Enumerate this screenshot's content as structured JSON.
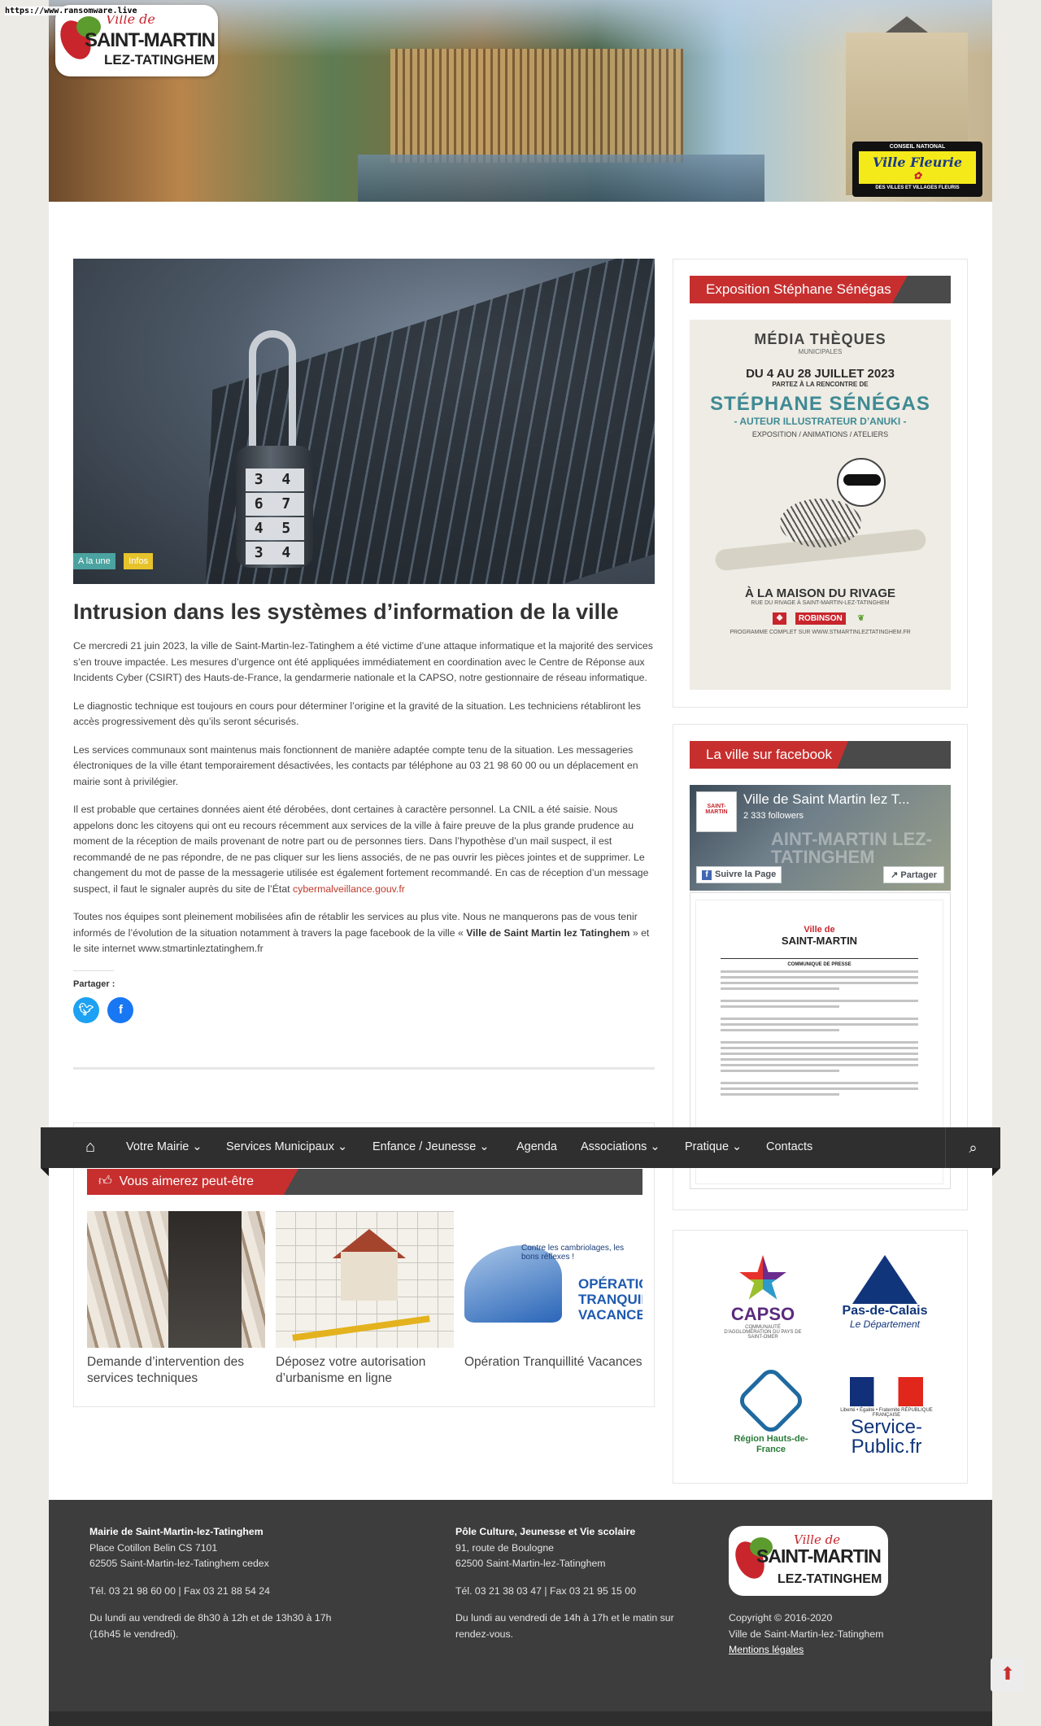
{
  "overlay_url": "https://www.ransomware.live",
  "site": {
    "logo_line1": "Ville de",
    "logo_line2": "SAINT-MARTIN",
    "logo_line3": "LEZ-TATINGHEM",
    "badge_top": "CONSEIL NATIONAL",
    "badge_mid": "Ville Fleurie",
    "badge_bot": "DES VILLES ET VILLAGES FLEURIS"
  },
  "article": {
    "tags": [
      "A la une",
      "Infos"
    ],
    "title": "Intrusion dans les systèmes d’information de la ville",
    "p1": "Ce mercredi 21 juin 2023, la ville de Saint-Martin-lez-Tatinghem a été victime d’une attaque informatique et la majorité des services s’en trouve impactée. Les mesures d’urgence ont été appliquées immédiatement en coordination avec le Centre de Réponse aux Incidents Cyber (CSIRT) des Hauts-de-France, la gendarmerie nationale et la CAPSO, notre gestionnaire de réseau informatique.",
    "p2": "Le diagnostic technique est toujours en cours pour déterminer l’origine et la gravité de la situation. Les techniciens rétabliront les accès progressivement dès qu’ils seront sécurisés.",
    "p3": "Les services communaux sont maintenus mais fonctionnent de manière adaptée compte tenu de la situation. Les messageries électroniques de la ville étant temporairement désactivées, les contacts par téléphone au 03 21 98 60 00 ou un déplacement en mairie sont à privilégier.",
    "p4": "Il est probable que certaines données aient été dérobées, dont certaines à caractère personnel. La CNIL a été saisie. Nous appelons donc les citoyens qui ont eu recours récemment aux services de la ville à faire preuve de la plus grande prudence au moment de la réception de mails provenant de notre part ou de personnes tiers. Dans l’hypothèse d’un mail suspect, il est recommandé de ne pas répondre, de ne pas cliquer sur les liens associés, de ne pas ouvrir les pièces jointes et de supprimer. Le changement du mot de passe de la messagerie utilisée est également fortement recommandé. En cas de réception d’un message suspect, il faut le signaler auprès du site de l’État",
    "p4_link": "cybermalveillance.gouv.fr",
    "p5_a": "Toutes nos équipes sont pleinement mobilisées afin de rétablir les services au plus vite. Nous ne manquerons pas de vous tenir informés de l’évolution de la situation notamment à travers la page facebook de la ville «",
    "p5_strong": "Ville de Saint Martin lez Tatinghem",
    "p5_b": "» et le site internet www.stmartinleztatinghem.fr",
    "share_label": "Partager :",
    "lock_digits": [
      "3 4",
      "6 7",
      "4 5",
      "3 4"
    ]
  },
  "nav": {
    "items": [
      "Votre Mairie ⌄",
      "Services Municipaux ⌄",
      "Enfance / Jeunesse ⌄",
      "Agenda",
      "Associations ⌄",
      "Pratique ⌄",
      "Contacts"
    ]
  },
  "related": {
    "title": "Vous aimerez peut-être",
    "cards": [
      {
        "caption": "Demande d’intervention des services techniques"
      },
      {
        "caption": "Déposez votre autorisation d’urbanisme en ligne"
      },
      {
        "caption": "Opération Tranquillité Vacances"
      }
    ],
    "ops_line": "Contre les cambriolages, les bons réflexes !",
    "ops_title": "OPÉRATION TRANQUILLITÉ VACANCES"
  },
  "sidebar": {
    "expo_title": "Exposition Stéphane Sénégas",
    "poster": {
      "media": "MÉDIA THÈQUES",
      "media_sub": "MUNICIPALES",
      "dates": "DU 4 AU 28 JUILLET 2023",
      "meet": "PARTEZ À LA RENCONTRE DE",
      "name": "STÉPHANE SÉNÉGAS",
      "role": "- AUTEUR ILLUSTRATEUR D’ANUKI -",
      "expo": "EXPOSITION / ANIMATIONS / ATELIERS",
      "maison": "À LA MAISON DU RIVAGE",
      "addr": "RUE DU RIVAGE À SAINT-MARTIN-LEZ-TATINGHEM",
      "logo_robinson": "ROBINSON",
      "prog": "PROGRAMME COMPLET SUR WWW.STMARTINLEZTATINGHEM.FR"
    },
    "fb_title": "La ville sur facebook",
    "fb": {
      "page_name": "Ville de Saint Martin lez T...",
      "followers": "2 333 followers",
      "follow_btn": "Suivre la Page",
      "share_btn": "Partager",
      "watermark": "AINT-MARTIN LEZ-TATINGHEM",
      "doc_title": "COMMUNIQUE DE PRESSE",
      "doc_logo": "SAINT-MARTIN"
    },
    "partners": {
      "capso": "CAPSO",
      "capso_sub": "COMMUNAUTÉ D'AGGLOMÉRATION DU PAYS DE SAINT-OMER",
      "pdc": "Pas-de-Calais",
      "pdc_sub": "Le Département",
      "hdf": "Région Hauts-de-France",
      "rf": "Liberté • Égalité • Fraternité RÉPUBLIQUE FRANÇAISE",
      "sp": "Service-Public.fr"
    }
  },
  "footer": {
    "c1_title": "Mairie de Saint-Martin-lez-Tatinghem",
    "c1_addr1": "Place Cotillon Belin CS 7101",
    "c1_addr2": "62505 Saint-Martin-lez-Tatinghem cedex",
    "c1_tel": "Tél. 03 21 98 60 00 | Fax 03 21 88 54 24",
    "c1_hours": "Du lundi au vendredi de 8h30 à 12h et de 13h30 à 17h (16h45 le vendredi).",
    "c2_title": "Pôle Culture, Jeunesse et Vie scolaire",
    "c2_addr1": "91, route de Boulogne",
    "c2_addr2": "62500 Saint-Martin-lez-Tatinghem",
    "c2_tel": "Tél. 03 21 38 03 47 | Fax 03 21 95 15 00",
    "c2_hours": "Du lundi au vendredi de 14h à 17h et le matin sur rendez-vous.",
    "copyright": "Copyright © 2016-2020",
    "org": "Ville de Saint-Martin-lez-Tatinghem",
    "legal": "Mentions légales"
  }
}
